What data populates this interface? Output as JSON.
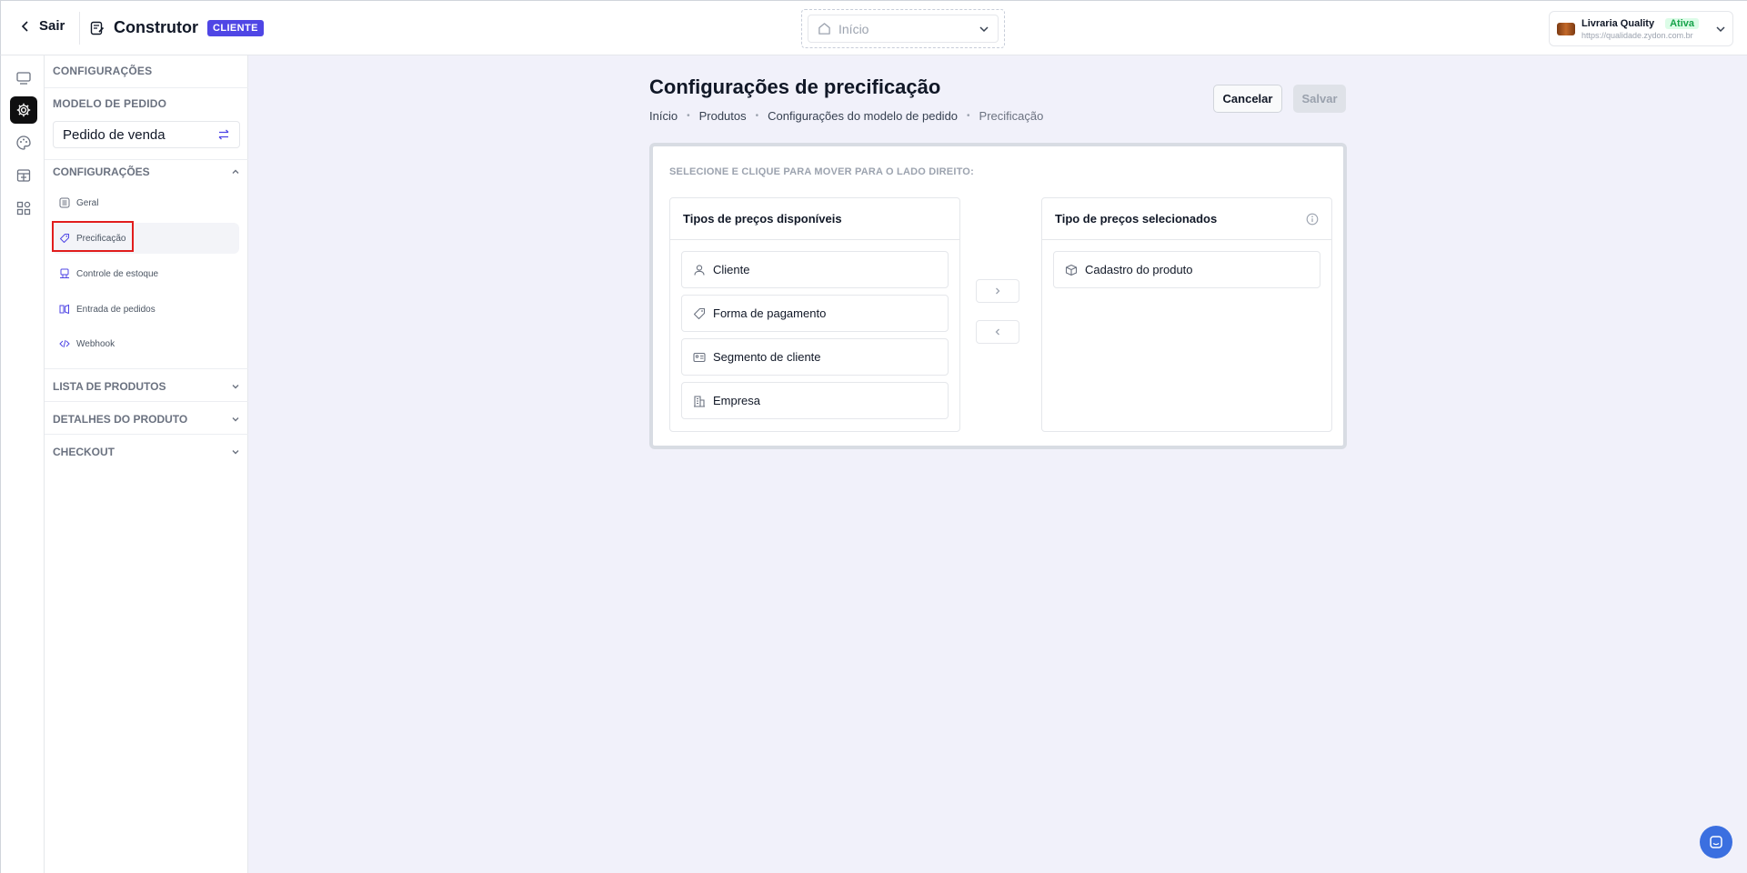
{
  "header": {
    "back_label": "Sair",
    "title": "Construtor",
    "badge": "CLIENTE",
    "page_select_value": "Início",
    "store": {
      "name": "Livraria Quality",
      "status": "Ativa",
      "url": "https://qualidade.zydon.com.br"
    }
  },
  "rail": {
    "icons": [
      "layout-icon",
      "gear-icon",
      "palette-icon",
      "store-icon",
      "apps-icon"
    ],
    "active": "gear-icon"
  },
  "sidebar": {
    "title": "CONFIGURAÇÕES",
    "model_heading": "MODELO DE PEDIDO",
    "model_value": "Pedido de venda",
    "config_section": "CONFIGURAÇÕES",
    "items": [
      {
        "label": "Geral",
        "icon": "list-icon"
      },
      {
        "label": "Precificação",
        "icon": "tag-icon"
      },
      {
        "label": "Controle de estoque",
        "icon": "box-icon"
      },
      {
        "label": "Entrada de pedidos",
        "icon": "funnel-icon"
      },
      {
        "label": "Webhook",
        "icon": "code-icon"
      }
    ],
    "active_item": "Precificação",
    "sections": [
      "LISTA DE PRODUTOS",
      "DETALHES DO PRODUTO",
      "CHECKOUT"
    ]
  },
  "main": {
    "title": "Configurações de precificação",
    "breadcrumb": [
      "Início",
      "Produtos",
      "Configurações do modelo de pedido",
      "Precificação"
    ],
    "cancel_label": "Cancelar",
    "save_label": "Salvar",
    "instruction": "SELECIONE E CLIQUE PARA MOVER PARA O LADO DIREITO:",
    "available_title": "Tipos de preços disponíveis",
    "available": [
      {
        "label": "Cliente",
        "icon": "user-icon"
      },
      {
        "label": "Forma de pagamento",
        "icon": "tag-icon"
      },
      {
        "label": "Segmento de cliente",
        "icon": "id-card-icon"
      },
      {
        "label": "Empresa",
        "icon": "building-icon"
      }
    ],
    "selected_title": "Tipo de preços selecionados",
    "selected": [
      {
        "label": "Cadastro do produto",
        "icon": "package-icon"
      }
    ]
  },
  "colors": {
    "accent": "#4f46e5",
    "active_rail": "#0f0f10",
    "highlight": "#e11d1d",
    "chat": "#3b6fe0",
    "status_green": "#16a34a"
  }
}
